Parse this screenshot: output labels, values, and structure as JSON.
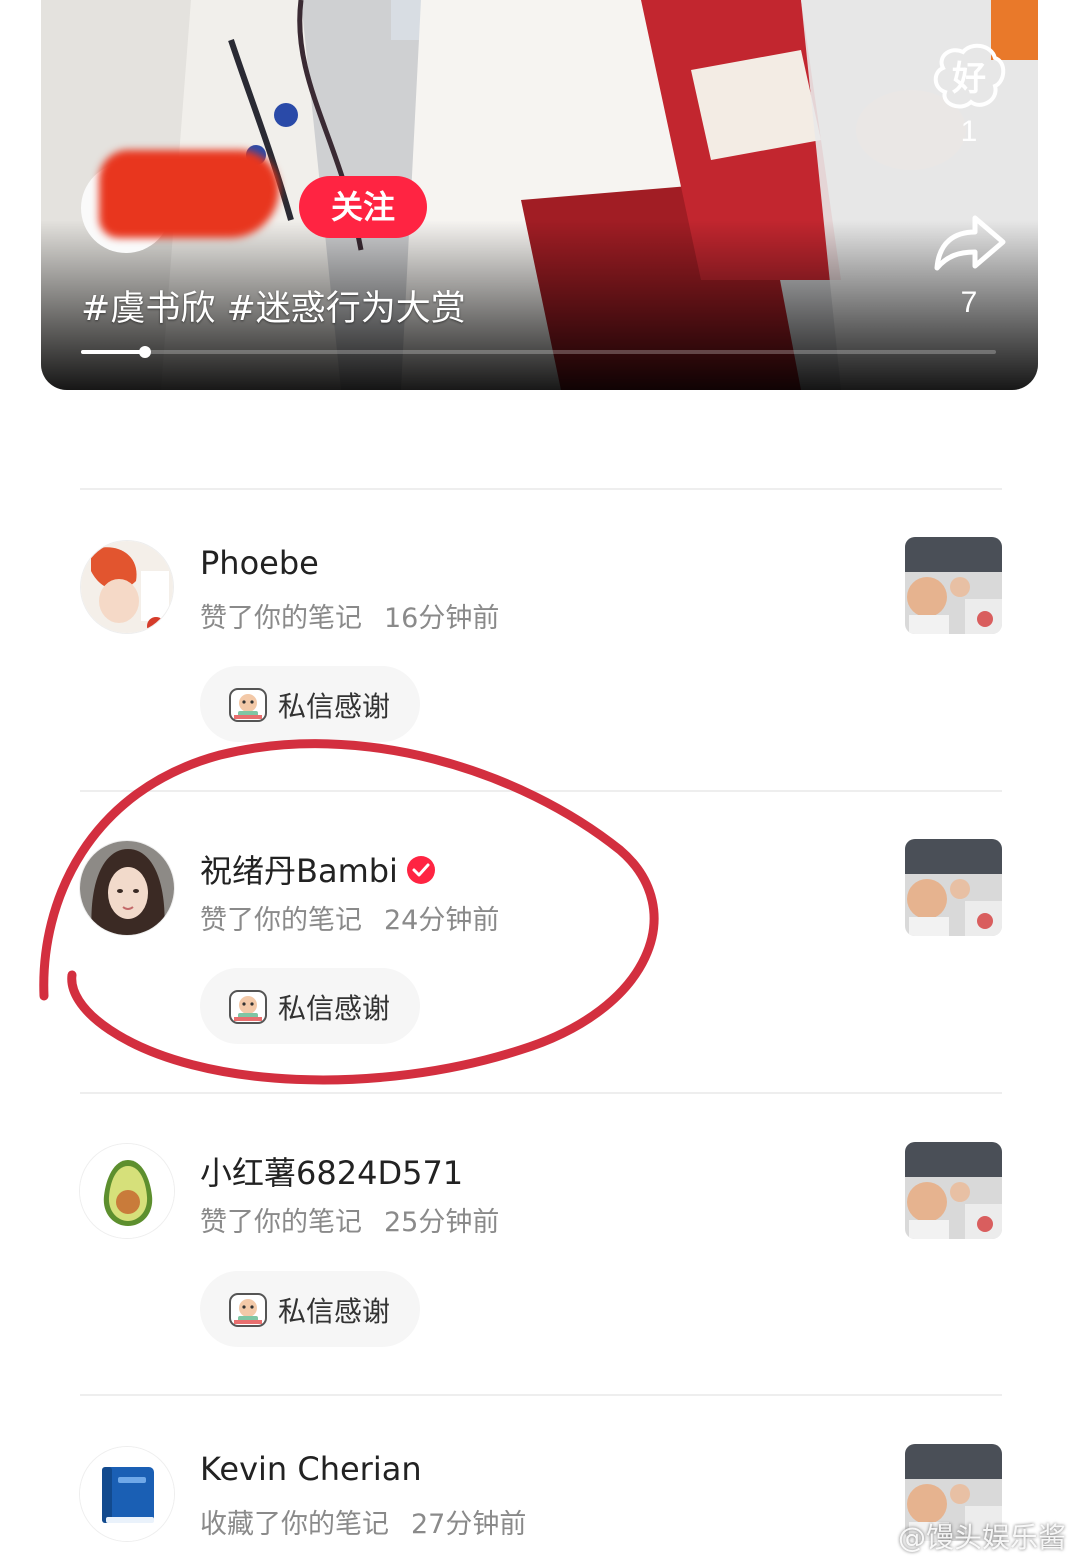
{
  "video": {
    "follow_label": "关注",
    "tags": "#虞书欣 #迷惑行为大赏",
    "like_icon": "hao-sticker-icon",
    "like_count": "1",
    "share_count": "7",
    "progress": 0.07
  },
  "notifications": [
    {
      "user": "Phoebe",
      "verified": false,
      "action": "赞了你的笔记",
      "time": "16分钟前",
      "button": "私信感谢"
    },
    {
      "user": "祝绪丹Bambi",
      "verified": true,
      "action": "赞了你的笔记",
      "time": "24分钟前",
      "button": "私信感谢"
    },
    {
      "user": "小红薯6824D571",
      "verified": false,
      "action": "赞了你的笔记",
      "time": "25分钟前",
      "button": "私信感谢"
    },
    {
      "user": "Kevin Cherian",
      "verified": false,
      "action": "收藏了你的笔记",
      "time": "27分钟前"
    }
  ],
  "annotation": {
    "color": "#d32f3f"
  },
  "watermark": "@馒头娱乐酱"
}
